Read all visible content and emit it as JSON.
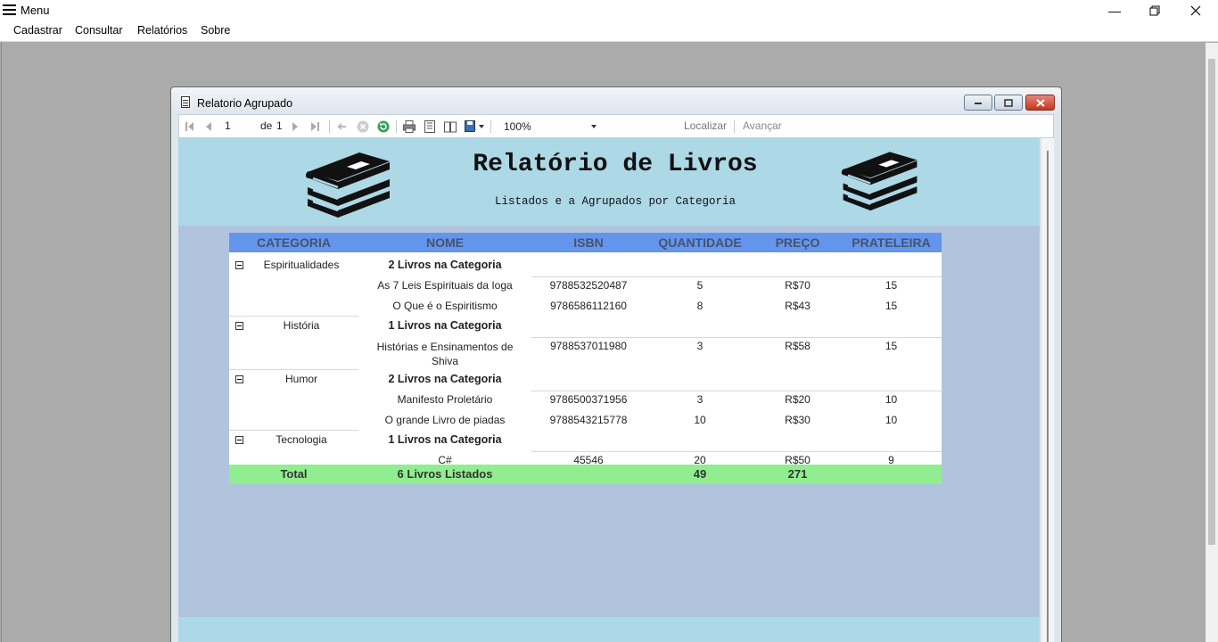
{
  "window": {
    "title": "Menu"
  },
  "menubar": {
    "items": [
      "Cadastrar",
      "Consultar",
      "Relatórios",
      "Sobre"
    ]
  },
  "child": {
    "title": "Relatorio Agrupado"
  },
  "toolbar": {
    "page": "1",
    "of_label": "de",
    "total_pages": "1",
    "zoom": "100%",
    "find_label": "Localizar",
    "next_label": "Avançar"
  },
  "report": {
    "title": "Relatório de Livros",
    "subtitle": "Listados e a Agrupados por Categoria",
    "columns": [
      "CATEGORIA",
      "NOME",
      "ISBN",
      "QUANTIDADE",
      "PREÇO",
      "PRATELEIRA"
    ],
    "groups": [
      {
        "category": "Espiritualidades",
        "count_label": "2 Livros na Categoria",
        "rows": [
          {
            "nome": "As 7 Leis Espirituais da Ioga",
            "isbn": "9788532520487",
            "quantidade": "5",
            "preco": "R$70",
            "prateleira": "15"
          },
          {
            "nome": "O Que é o Espiritismo",
            "isbn": "9786586112160",
            "quantidade": "8",
            "preco": "R$43",
            "prateleira": "15"
          }
        ]
      },
      {
        "category": "História",
        "count_label": "1 Livros na Categoria",
        "rows": [
          {
            "nome": "Histórias e Ensinamentos de Shiva",
            "isbn": "9788537011980",
            "quantidade": "3",
            "preco": "R$58",
            "prateleira": "15"
          }
        ]
      },
      {
        "category": "Humor",
        "count_label": "2 Livros na Categoria",
        "rows": [
          {
            "nome": "Manifesto Proletário",
            "isbn": "9786500371956",
            "quantidade": "3",
            "preco": "R$20",
            "prateleira": "10"
          },
          {
            "nome": "O grande Livro de piadas",
            "isbn": "9788543215778",
            "quantidade": "10",
            "preco": "R$30",
            "prateleira": "10"
          }
        ]
      },
      {
        "category": "Tecnologia",
        "count_label": "1 Livros na Categoria",
        "rows": [
          {
            "nome": "C#",
            "isbn": "45546",
            "quantidade": "20",
            "preco": "R$50",
            "prateleira": "9"
          }
        ]
      }
    ],
    "total": {
      "label": "Total",
      "count_label": "6 Livros Listados",
      "quantidade": "49",
      "preco": "271"
    }
  },
  "colors": {
    "header_band": "#add8e6",
    "body_bg": "#b0c4de",
    "column_header": "#6495ed",
    "total_row": "#90ee90"
  },
  "icons": [
    "menu-icon",
    "minimize-icon",
    "restore-icon",
    "close-icon",
    "report-icon",
    "first-page-icon",
    "prev-page-icon",
    "next-page-icon",
    "last-page-icon",
    "back-icon",
    "stop-icon",
    "refresh-icon",
    "print-icon",
    "print-layout-icon",
    "page-setup-icon",
    "export-icon",
    "books-icon",
    "collapse-icon"
  ]
}
